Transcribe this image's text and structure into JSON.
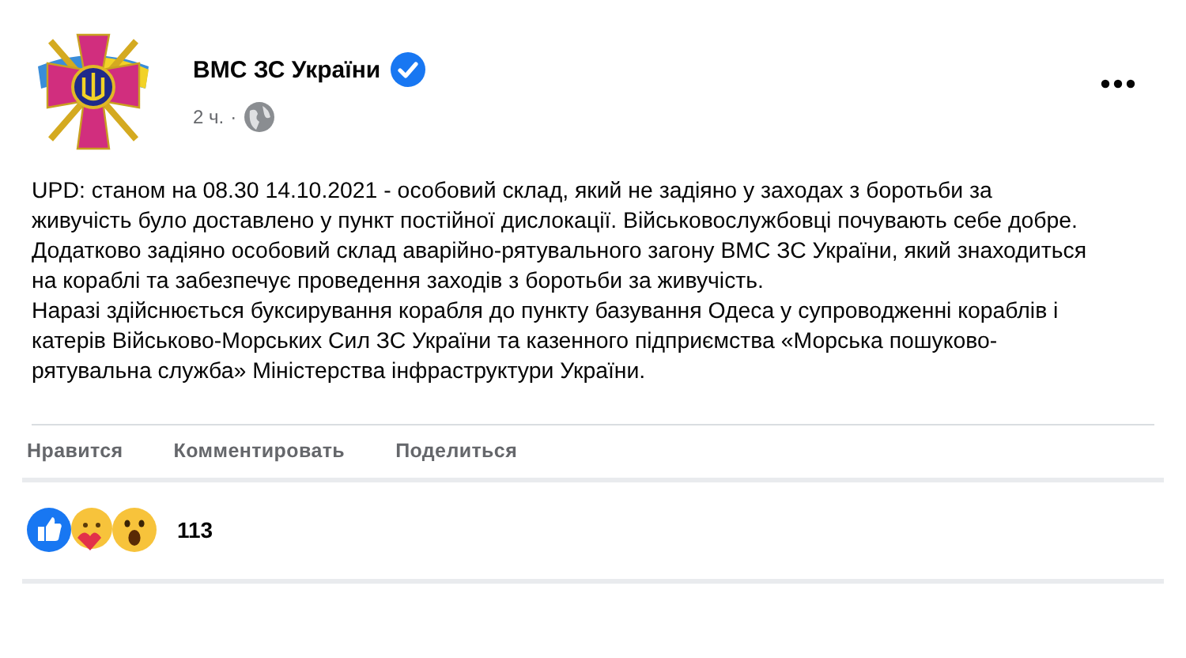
{
  "post": {
    "author": "ВМС ЗС України",
    "verified": true,
    "time": "2 ч.",
    "separator": "·",
    "paragraphs": [
      "UPD: станом на 08.30 14.10.2021 - особовий склад, який не задіяно у заходах з боротьби за живучість було доставлено у пункт постійної дислокації. Військовослужбовці почувають себе добре.",
      "Додатково задіяно особовий склад аварійно-рятувального загону ВМС ЗС України, який знаходиться на кораблі та забезпечує проведення заходів з боротьби за живучість.",
      "Наразі здійснюється буксирування корабля до пункту базування Одеса у супроводженні кораблів і катерів Військово-Морських Сил ЗС України та казенного підприємства «Морська пошуково-рятувальна служба» Міністерства інфраструктури України."
    ]
  },
  "actions": [
    "Нравится",
    "Комментировать",
    "Поделиться"
  ],
  "reactions": {
    "icons": [
      {
        "kind": "like"
      },
      {
        "kind": "care"
      },
      {
        "kind": "wow"
      }
    ],
    "count": "113"
  }
}
